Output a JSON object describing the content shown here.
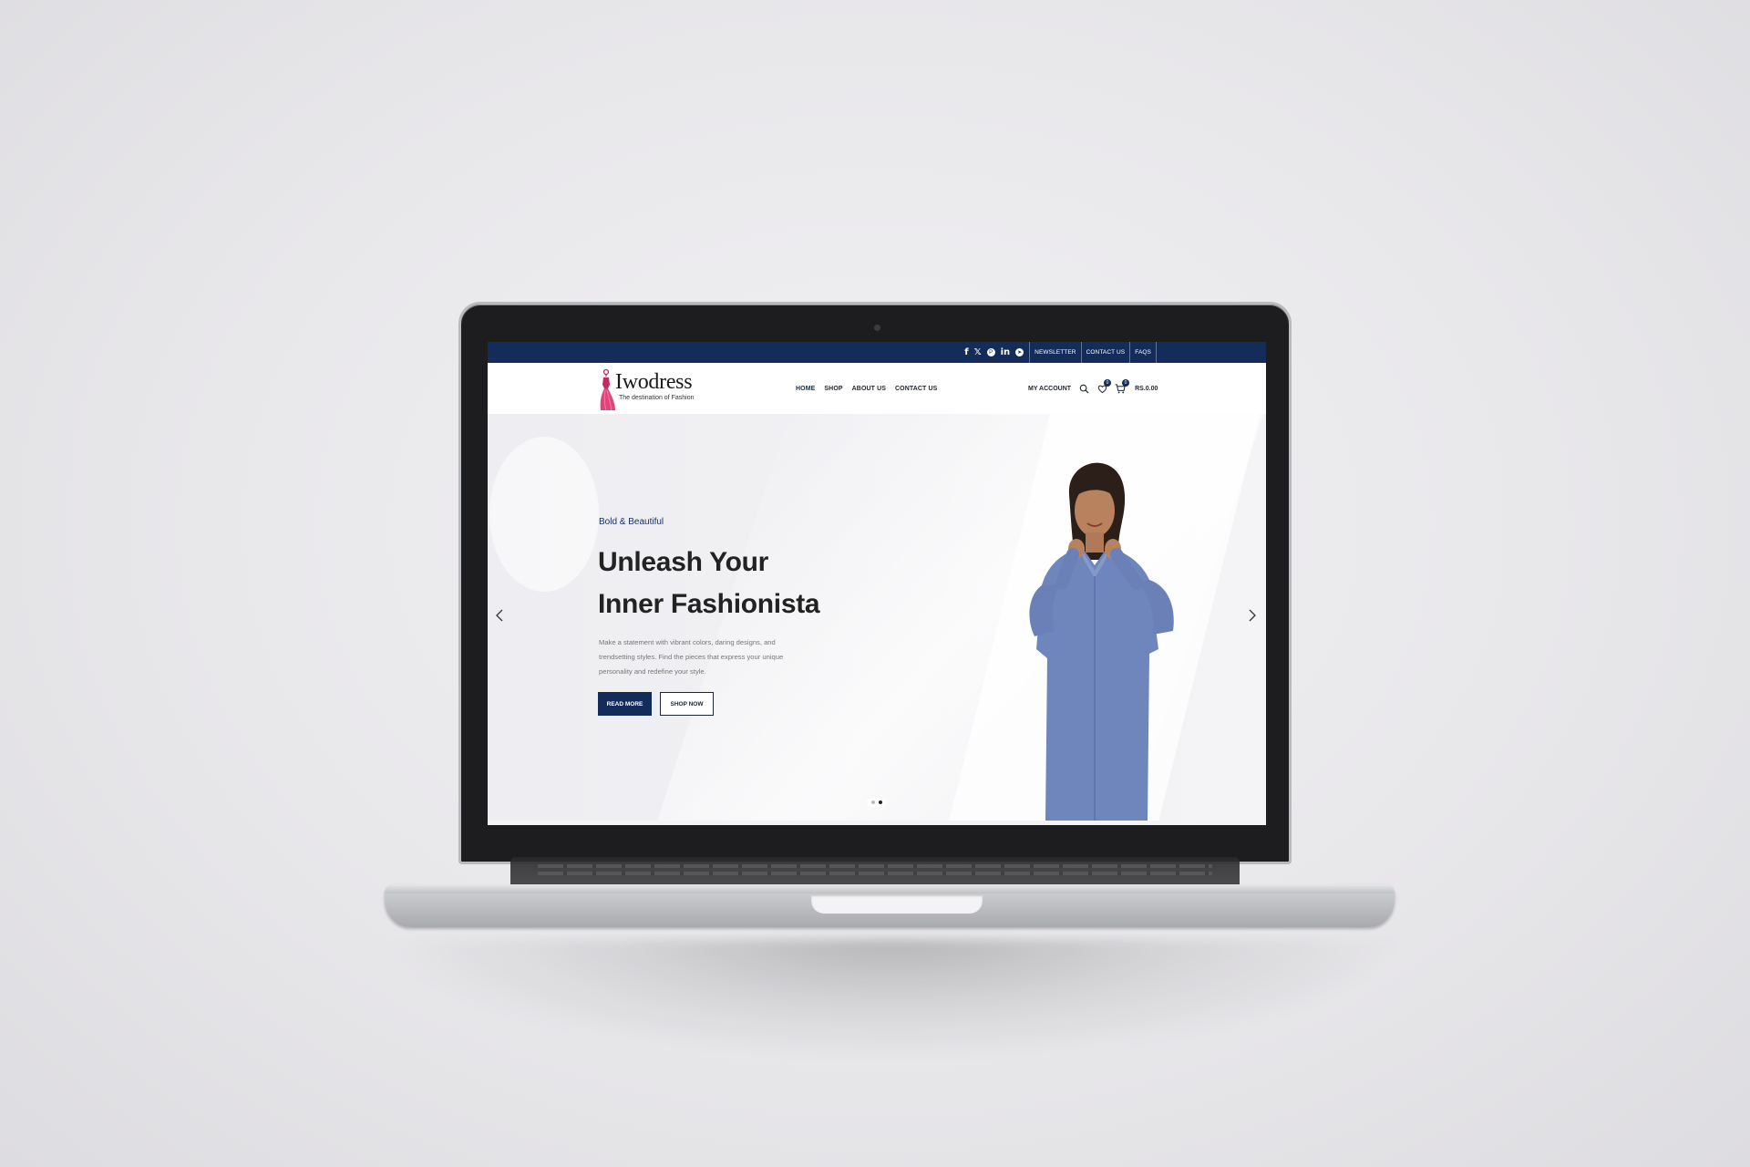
{
  "site": {
    "brand": {
      "name": "Iwodress",
      "tagline": "The destination of Fashion"
    },
    "top_bar": {
      "social_icons": [
        "facebook-icon",
        "x-icon",
        "pinterest-icon",
        "linkedin-icon",
        "telegram-icon"
      ],
      "links": [
        "NEWSLETTER",
        "CONTACT US",
        "FAQS"
      ]
    },
    "nav": {
      "items": [
        "HOME",
        "SHOP",
        "ABOUT US",
        "CONTACT US"
      ],
      "active": "HOME"
    },
    "header_actions": {
      "account_label": "MY ACCOUNT",
      "wishlist_count": "0",
      "cart_count": "0",
      "cart_total": "RS.0.00"
    },
    "hero": {
      "eyebrow": "Bold & Beautiful",
      "title_line1": "Unleash Your",
      "title_line2": "Inner Fashionista",
      "text_line1": "Make a statement with vibrant colors, daring designs, and",
      "text_line2": "trendsetting styles. Find the pieces that express your unique",
      "text_line3": "personality and redefine your style.",
      "button_primary": "READ MORE",
      "button_secondary": "SHOP NOW",
      "slides_total": 2,
      "active_slide": 2
    }
  },
  "colors": {
    "brand_navy": "#132c5a",
    "logo_pink": "#e0447a",
    "background": "#e8e7ea"
  }
}
